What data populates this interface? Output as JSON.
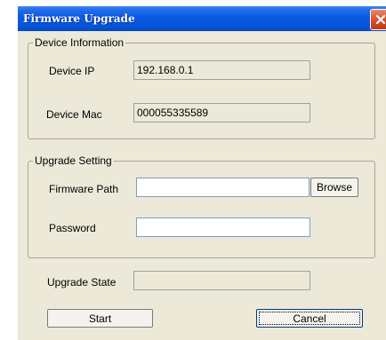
{
  "window": {
    "title": "Firmware Upgrade"
  },
  "device_info": {
    "legend": "Device Information",
    "ip_label": "Device IP",
    "ip_value": "192.168.0.1",
    "mac_label": "Device Mac",
    "mac_value": "000055335589"
  },
  "upgrade_setting": {
    "legend": "Upgrade Setting",
    "path_label": "Firmware Path",
    "path_value": "",
    "browse_label": "Browse",
    "password_label": "Password",
    "password_value": ""
  },
  "upgrade_state": {
    "label": "Upgrade State",
    "value": ""
  },
  "buttons": {
    "start_label": "Start",
    "cancel_label": "Cancel"
  },
  "icons": {
    "close": "close-icon"
  },
  "colors": {
    "titlebar": "#0553d9",
    "dialog_bg": "#ece9d8",
    "close_button": "#d44a26"
  }
}
